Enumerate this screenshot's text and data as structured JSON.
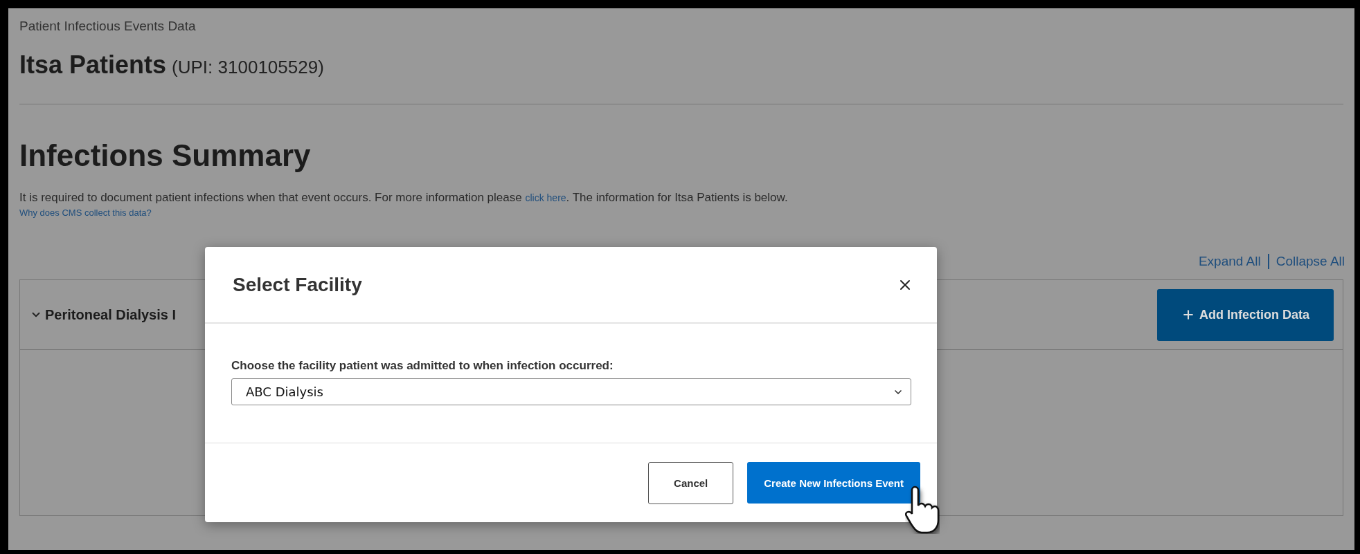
{
  "page": {
    "breadcrumb": "Patient Infectious Events Data",
    "patient_name": "Itsa Patients",
    "patient_id": "(UPI: 3100105529)",
    "heading": "Infections Summary",
    "description": {
      "before": "It is required to document patient infections when that event occurs. For more information please",
      "link": "click here",
      "after": ". The information for Itsa Patients is below."
    },
    "cms_link": "Why does CMS collect this data?",
    "expand_all": "Expand All",
    "collapse_all": "Collapse All",
    "panel": {
      "title": "Peritoneal Dialysis I",
      "expanded": true,
      "add_button": "Add Infection Data"
    }
  },
  "modal": {
    "title": "Select Facility",
    "label": "Choose the facility patient was admitted to when infection occurred:",
    "facility": "ABC Dialysis",
    "buttons": [
      {
        "kind": "secondary",
        "label": "Cancel"
      },
      {
        "kind": "primary",
        "label": "Create New Infections Event",
        "hovered": true
      }
    ]
  }
}
